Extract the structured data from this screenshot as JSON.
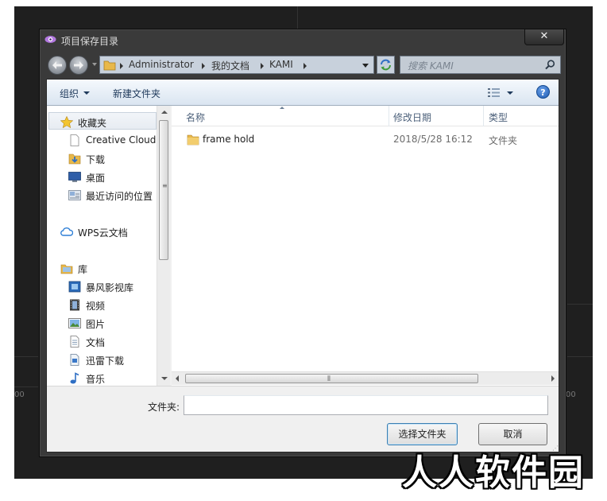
{
  "window": {
    "title": "项目保存目录",
    "close_label": "✕"
  },
  "backdrop": {
    "left_number": "00",
    "right_number": "00"
  },
  "address_bar": {
    "crumbs": [
      "Administrator",
      "我的文档",
      "KAMI"
    ]
  },
  "search": {
    "placeholder": "搜索 KAMI"
  },
  "toolbar": {
    "organize_label": "组织",
    "new_folder_label": "新建文件夹",
    "help_label": "?"
  },
  "nav_pane": {
    "favorites_label": "收藏夹",
    "favorites": [
      "Creative Cloud",
      "下载",
      "桌面",
      "最近访问的位置"
    ],
    "wps_label": "WPS云文档",
    "library_label": "库",
    "library": [
      "暴风影视库",
      "视频",
      "图片",
      "文档",
      "迅雷下载",
      "音乐"
    ]
  },
  "file_list": {
    "columns": [
      "名称",
      "修改日期",
      "类型"
    ],
    "rows": [
      {
        "name": "frame hold",
        "date": "2018/5/28 16:12",
        "type": "文件夹"
      }
    ]
  },
  "bottom": {
    "folder_label": "文件夹:",
    "folder_value": "",
    "select_button": "选择文件夹",
    "cancel_button": "取消"
  },
  "watermark": "人人软件园",
  "colors": {
    "toolbar_text": "#1e395b",
    "accent": "#1e5cb3",
    "folder": "#e8b84a"
  }
}
